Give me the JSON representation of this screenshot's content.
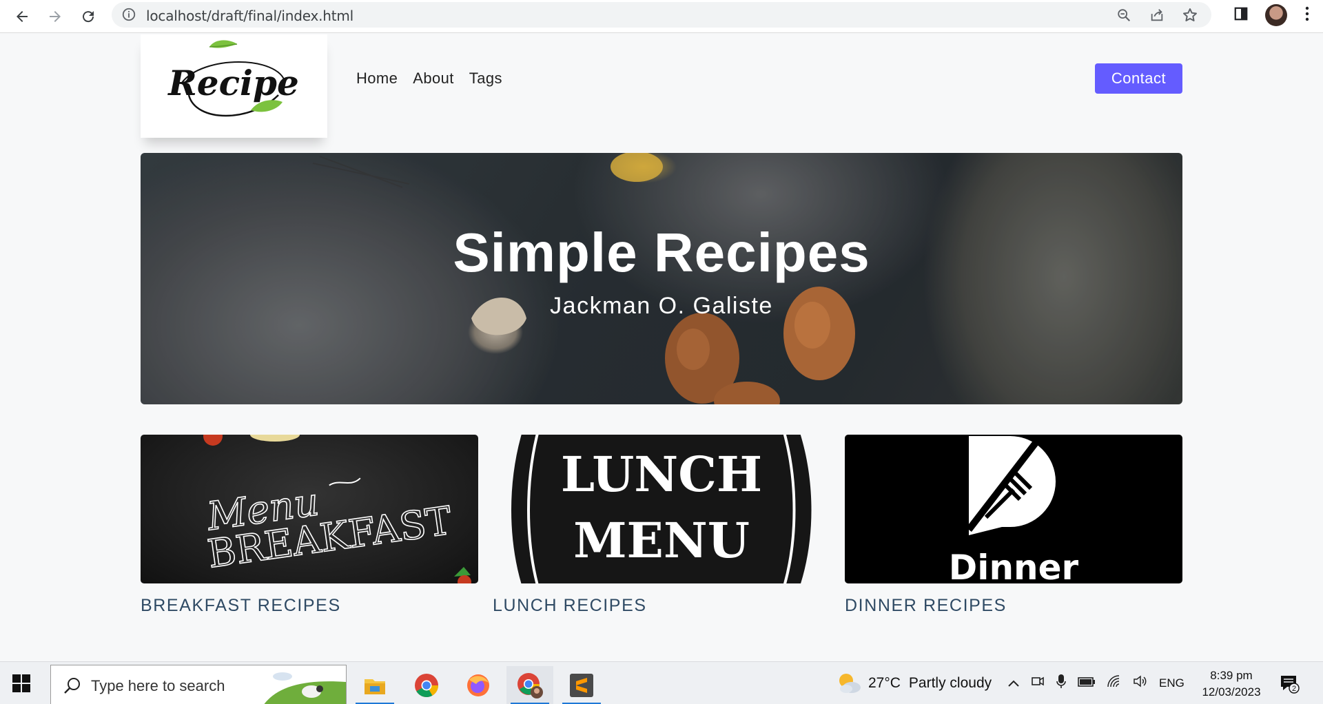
{
  "browser": {
    "url": "localhost/draft/final/index.html"
  },
  "header": {
    "logo_text": "Recipe",
    "nav": [
      "Home",
      "About",
      "Tags"
    ],
    "contact_label": "Contact"
  },
  "hero": {
    "title": "Simple Recipes",
    "subtitle": "Jackman O. Galiste"
  },
  "cards": [
    {
      "caption": "BREAKFAST RECIPES",
      "image_text_top": "Menu",
      "image_text_bottom": "BREAKFAST"
    },
    {
      "caption": "LUNCH RECIPES",
      "image_text_top": "LUNCH",
      "image_text_bottom": "MENU"
    },
    {
      "caption": "DINNER RECIPES",
      "image_text_bottom": "Dinner"
    }
  ],
  "taskbar": {
    "search_placeholder": "Type here to search",
    "weather_temp": "27°C",
    "weather_desc": "Partly cloudy",
    "language": "ENG",
    "time": "8:39 pm",
    "date": "12/03/2023",
    "notification_count": "2",
    "apps": [
      "file-explorer-icon",
      "chrome-icon",
      "firefox-icon",
      "chrome-profile-icon",
      "sublime-text-icon"
    ]
  },
  "colors": {
    "accent": "#645cff",
    "caption": "#2f4a64",
    "leaf": "#7cc23e"
  }
}
